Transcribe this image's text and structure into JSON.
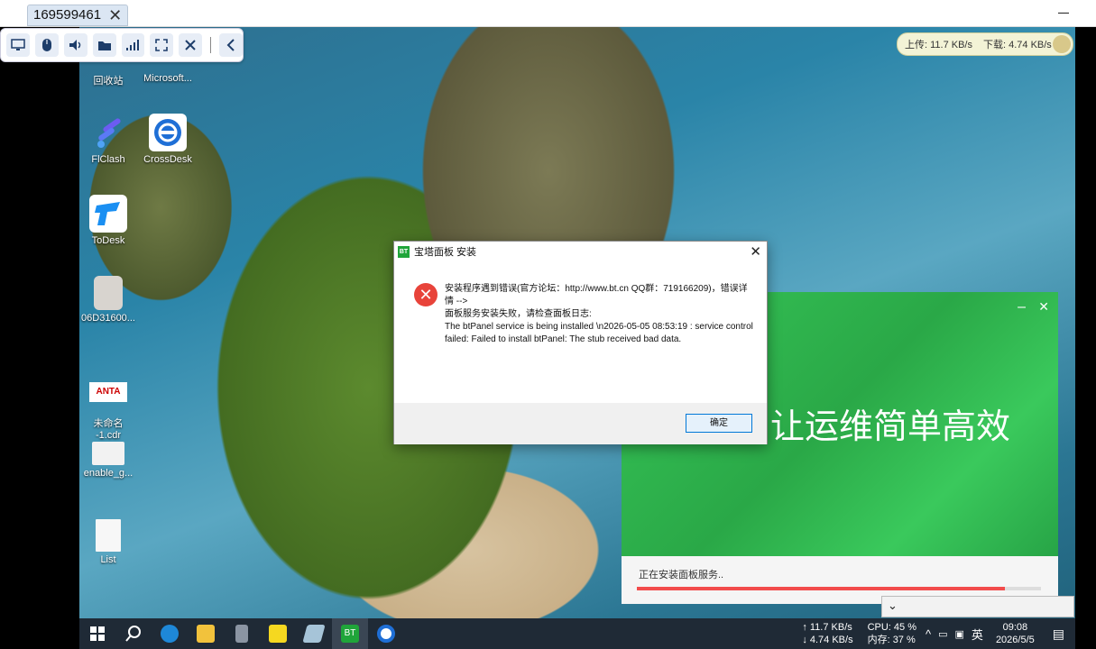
{
  "client": {
    "tab_title": "169599461",
    "close_glyph": "✕"
  },
  "toolbar": {
    "icons": [
      "monitor-icon",
      "mouse-icon",
      "volume-icon",
      "folder-icon",
      "signal-icon",
      "fullscreen-icon",
      "close-icon",
      "collapse-icon"
    ]
  },
  "speed_widget": {
    "upload": "上传: 11.7 KB/s",
    "download": "下载: 4.74 KB/s"
  },
  "desktop_icons": [
    {
      "label": "回收站"
    },
    {
      "label": "Microsoft..."
    },
    {
      "label": "FlClash"
    },
    {
      "label": "CrossDesk"
    },
    {
      "label": "ToDesk"
    },
    {
      "label": "06D31600..."
    },
    {
      "label": "未命名\n-1.cdr"
    },
    {
      "label": "enable_g..."
    },
    {
      "label": "List"
    }
  ],
  "installer": {
    "slogan": "让运维简单高效",
    "status": "正在安装面板服务..",
    "progress": 0.91,
    "min_glyph": "–",
    "close_glyph": "✕"
  },
  "dialog": {
    "title": "宝塔面板 安装",
    "app_badge": "BT",
    "message_lines": [
      "安装程序遇到错误(官方论坛：http://www.bt.cn  QQ群：719166209)，错误详情 -->",
      " 面板服务安装失败，请检查面板日志:",
      "The btPanel service is being installed \\n2026-05-05 08:53:19 : service control failed: Failed to install btPanel: The stub received bad data."
    ],
    "ok_label": "确定"
  },
  "taskbar": {
    "net_up": "↑ 11.7 KB/s",
    "net_down": "↓ 4.74 KB/s",
    "cpu": "CPU: 45 %",
    "mem": "内存: 37 %",
    "ime": "英",
    "time": "09:08",
    "date": "2026/5/5",
    "bt_label": "BT"
  },
  "colors": {
    "installer_green": "#2bb54a",
    "progress_red": "#f24b4b",
    "dialog_ok_border": "#0078d7"
  }
}
